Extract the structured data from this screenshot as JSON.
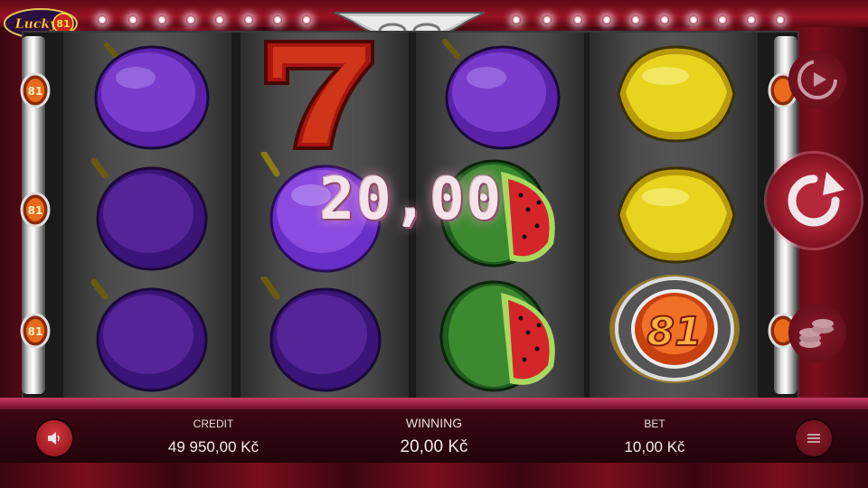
{
  "brand": {
    "logo_text": "Lucky 81"
  },
  "win_display": {
    "amount": "20,00"
  },
  "reels": [
    {
      "id": 1,
      "symbols": [
        "plum",
        "plum",
        "plum"
      ]
    },
    {
      "id": 2,
      "symbols": [
        "seven",
        "plum",
        "plum"
      ]
    },
    {
      "id": 3,
      "symbols": [
        "plum",
        "watermelon",
        "watermelon"
      ]
    },
    {
      "id": 4,
      "symbols": [
        "lemon",
        "lemon",
        "81-badge"
      ]
    }
  ],
  "symbol_badge_text": "81",
  "side_controls": {
    "autoplay_icon": "autoplay-icon",
    "spin_icon": "spin-icon",
    "coins_icon": "coins-icon"
  },
  "footer": {
    "credit_label": "CREDIT",
    "credit_value": "49 950,00 Kč",
    "winning_label": "WINNING",
    "winning_value": "20,00 Kč",
    "bet_label": "BET",
    "bet_value": "10,00 Kč",
    "sound_icon": "speaker-icon",
    "menu_icon": "hamburger-menu-icon"
  },
  "colors": {
    "curtain": "#7a0e1c",
    "button_red": "#c02630",
    "plum": "#6a2fb8",
    "lemon": "#e6d31e",
    "watermelon_rind": "#2f7a2a",
    "watermelon_flesh": "#d4282a",
    "seven": "#c8281e"
  }
}
